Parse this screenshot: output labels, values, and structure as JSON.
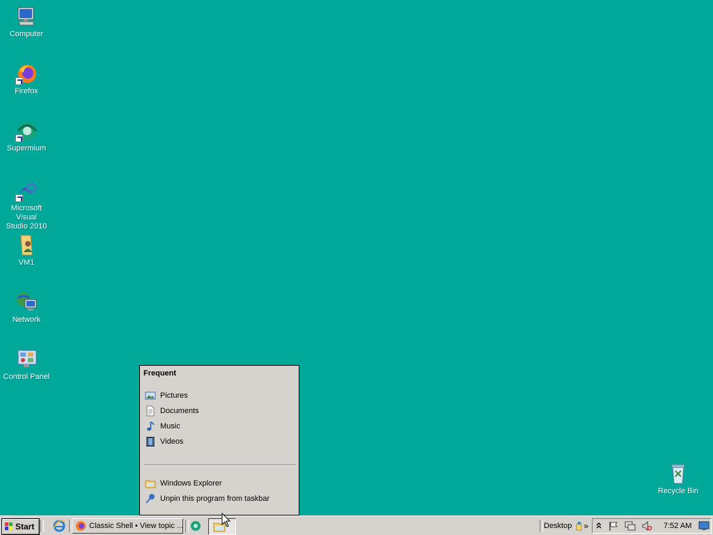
{
  "desktop": {
    "icons": [
      {
        "label": "Computer",
        "icon": "computer-icon"
      },
      {
        "label": "Firefox",
        "icon": "firefox-icon"
      },
      {
        "label": "Supermium",
        "icon": "supermium-icon"
      },
      {
        "label": "Microsoft Visual Studio 2010",
        "line1": "Microsoft Visual",
        "line2": "Studio 2010",
        "icon": "visual-studio-icon"
      },
      {
        "label": "VM1",
        "icon": "folder-user-icon"
      },
      {
        "label": "Network",
        "icon": "network-icon"
      },
      {
        "label": "Control Panel",
        "icon": "control-panel-icon"
      },
      {
        "label": "Recycle Bin",
        "icon": "recycle-bin-icon"
      }
    ],
    "background_color": "#00A89A"
  },
  "jumplist": {
    "heading": "Frequent",
    "frequent_items": [
      {
        "label": "Pictures",
        "icon": "pictures-icon"
      },
      {
        "label": "Documents",
        "icon": "documents-icon"
      },
      {
        "label": "Music",
        "icon": "music-icon"
      },
      {
        "label": "Videos",
        "icon": "videos-icon"
      }
    ],
    "task_items": [
      {
        "label": "Windows Explorer",
        "icon": "windows-explorer-icon"
      },
      {
        "label": "Unpin this program from taskbar",
        "icon": "unpin-icon"
      }
    ]
  },
  "taskbar": {
    "start_label": "Start",
    "quick_launch": [
      {
        "icon": "internet-explorer-icon"
      }
    ],
    "tasks": [
      {
        "label": "Classic Shell • View topic ...",
        "icon": "firefox-icon",
        "pressed": false
      },
      {
        "label": "",
        "icon": "supermium-icon",
        "pressed": false
      },
      {
        "label": "",
        "icon": "windows-explorer-icon",
        "pressed": true
      }
    ],
    "desktop_toolbar_label": "Desktop",
    "chevron": "»",
    "tray": {
      "clock": "7:52 AM",
      "icons": [
        "show-hidden-icons-icon",
        "action-center-flag-icon",
        "network-tray-icon",
        "volume-muted-icon",
        "show-desktop-icon"
      ]
    }
  }
}
